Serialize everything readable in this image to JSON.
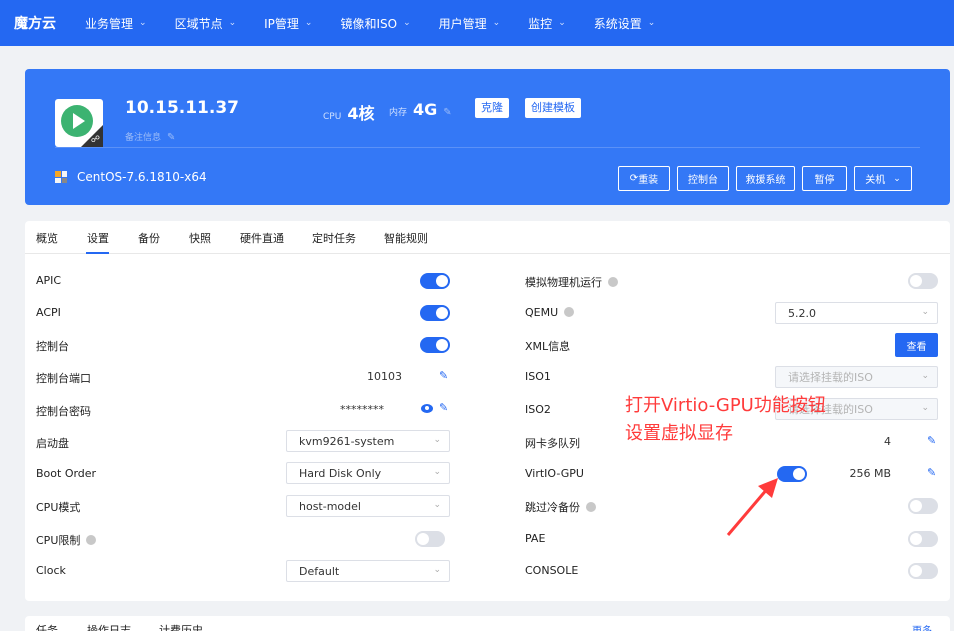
{
  "nav": {
    "logo": "魔方云",
    "items": [
      {
        "label": "业务管理"
      },
      {
        "label": "区域节点"
      },
      {
        "label": "IP管理"
      },
      {
        "label": "镜像和ISO"
      },
      {
        "label": "用户管理"
      },
      {
        "label": "监控"
      },
      {
        "label": "系统设置"
      }
    ]
  },
  "vm": {
    "ip": "10.15.11.37",
    "note_placeholder": "备注信息",
    "cpu_label": "CPU",
    "cpu_value": "4核",
    "mem_label": "内存",
    "mem_value": "4G",
    "clone_btn": "克隆",
    "template_btn": "创建模板",
    "os": "CentOS-7.6.1810-x64",
    "actions": {
      "reinstall": "重装",
      "console": "控制台",
      "rescue": "救援系统",
      "pause": "暂停",
      "shutdown": "关机"
    }
  },
  "tabs": [
    "概览",
    "设置",
    "备份",
    "快照",
    "硬件直通",
    "定时任务",
    "智能规则"
  ],
  "active_tab": "设置",
  "left": {
    "apic": "APIC",
    "acpi": "ACPI",
    "console": "控制台",
    "console_port_label": "控制台端口",
    "console_port_value": "10103",
    "console_pwd_label": "控制台密码",
    "console_pwd_value": "********",
    "boot_disk_label": "启动盘",
    "boot_disk_value": "kvm9261-system",
    "boot_order_label": "Boot Order",
    "boot_order_value": "Hard Disk Only",
    "cpu_mode_label": "CPU模式",
    "cpu_mode_value": "host-model",
    "cpu_limit_label": "CPU限制",
    "clock_label": "Clock",
    "clock_value": "Default"
  },
  "right": {
    "emulate_label": "模拟物理机运行",
    "qemu_label": "QEMU",
    "qemu_value": "5.2.0",
    "xml_label": "XML信息",
    "xml_btn": "查看",
    "iso1_label": "ISO1",
    "iso1_placeholder": "请选择挂载的ISO",
    "iso2_label": "ISO2",
    "iso2_placeholder": "请选择挂载的ISO",
    "nic_queue_label": "网卡多队列",
    "nic_queue_value": "4",
    "virtio_label": "VirtIO-GPU",
    "virtio_value": "256 MB",
    "skip_backup_label": "跳过冷备份",
    "pae_label": "PAE",
    "console2_label": "CONSOLE"
  },
  "annotation": {
    "line1": "打开Virtio-GPU功能按钮",
    "line2": "设置虚拟显存"
  },
  "bottom_tabs": [
    "任务",
    "操作日志",
    "计费历史"
  ],
  "bottom_more": "更多",
  "colors": {
    "brand": "#2468f2",
    "hero": "#3478f6",
    "annotation": "#ff3b3b"
  }
}
